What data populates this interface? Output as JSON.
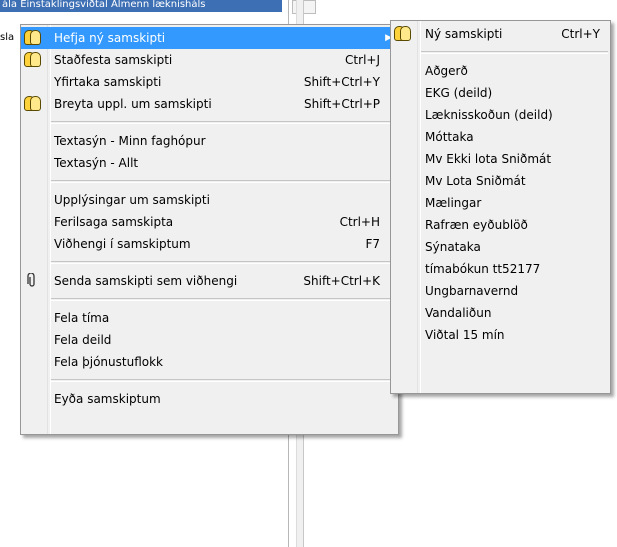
{
  "background": {
    "selected_row": "ála  Einstaklingsviðtal  Almenn læknisháls",
    "left_text": "sla"
  },
  "main_menu": {
    "items": [
      {
        "label": "Hefja ný samskipti",
        "shortcut": "",
        "icon": "people-icon",
        "submenu": true
      },
      {
        "label": "Staðfesta samskipti",
        "shortcut": "Ctrl+J",
        "icon": "people-icon"
      },
      {
        "label": "Yfirtaka samskipti",
        "shortcut": "Shift+Ctrl+Y",
        "icon": ""
      },
      {
        "label": "Breyta uppl. um samskipti",
        "shortcut": "Shift+Ctrl+P",
        "icon": "people-icon"
      },
      {
        "separator": true
      },
      {
        "label": "Textasýn - Minn faghópur",
        "shortcut": "",
        "icon": ""
      },
      {
        "label": "Textasýn - Allt",
        "shortcut": "",
        "icon": ""
      },
      {
        "separator": true
      },
      {
        "label": "Upplýsingar um samskipti",
        "shortcut": "",
        "icon": ""
      },
      {
        "label": "Ferilsaga samskipta",
        "shortcut": "Ctrl+H",
        "icon": ""
      },
      {
        "label": "Viðhengi í samskiptum",
        "shortcut": "F7",
        "icon": ""
      },
      {
        "separator": true
      },
      {
        "label": "Senda samskipti sem viðhengi",
        "shortcut": "Shift+Ctrl+K",
        "icon": "paperclip-icon"
      },
      {
        "separator": true
      },
      {
        "label": "Fela tíma",
        "shortcut": "",
        "icon": ""
      },
      {
        "label": "Fela deild",
        "shortcut": "",
        "icon": ""
      },
      {
        "label": "Fela þjónustuflokk",
        "shortcut": "",
        "icon": ""
      },
      {
        "separator": true
      },
      {
        "label": "Eyða samskiptum",
        "shortcut": "",
        "icon": ""
      }
    ]
  },
  "sub_menu": {
    "items": [
      {
        "label": "Ný samskipti",
        "shortcut": "Ctrl+Y",
        "icon": "people-icon"
      },
      {
        "separator": true
      },
      {
        "label": "Aðgerð"
      },
      {
        "label": "EKG (deild)"
      },
      {
        "label": "Læknisskoðun (deild)"
      },
      {
        "label": "Móttaka"
      },
      {
        "label": "Mv Ekki lota Sniðmát"
      },
      {
        "label": "Mv Lota Sniðmát"
      },
      {
        "label": "Mælingar"
      },
      {
        "label": "Rafræn eyðublöð"
      },
      {
        "label": "Sýnataka"
      },
      {
        "label": "tímabókun tt52177"
      },
      {
        "label": "Ungbarnavernd"
      },
      {
        "label": "Vandaliðun"
      },
      {
        "label": "Viðtal 15 mín"
      }
    ]
  },
  "colors": {
    "highlight": "#3399ff",
    "menu_bg": "#f0f0f0"
  }
}
